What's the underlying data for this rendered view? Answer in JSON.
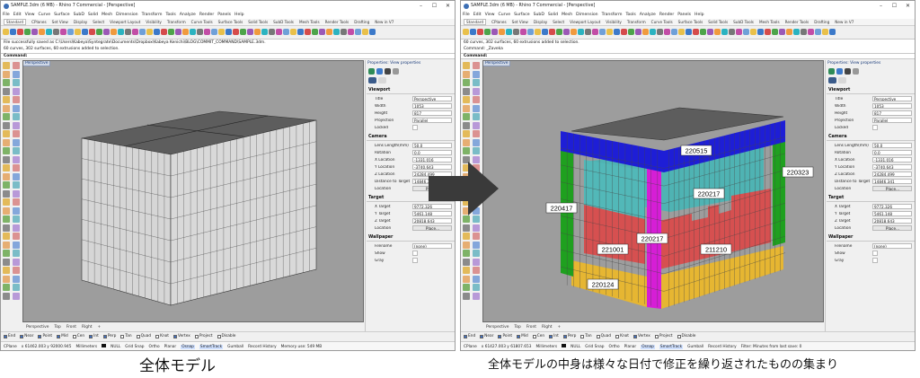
{
  "windows": [
    {
      "title": "SAMPLE.3dm (6 MB) - Rhino 7 Commercial - [Perspective]",
      "cmd_history": [
        "File successfully saved as C:\\Users\\Kabeya\\Syntegrate\\Documents\\Dropbox\\Kabeya Kenichi\\BLOG\\COMMIT_COMMAND\\SAMPLE.3dm.",
        "60 curves, 302 surfaces, 60 extrusions added to selection."
      ],
      "status": {
        "coords": "x 61462.003   y 92000.945",
        "units": "Millimeters",
        "memory": "Memory use: 549 MB"
      }
    },
    {
      "title": "SAMPLE.3dm (6 MB) - Rhino 7 Commercial - [Perspective]",
      "cmd_history": [
        "60 curves, 302 surfaces, 60 extrusions added to selection.",
        "Command: _Zaveka"
      ],
      "status": {
        "coords": "x 61427.003   y 61807.653",
        "units": "Millimeters",
        "memory": "Filter: Minutes from last save: 0"
      }
    }
  ],
  "menu": [
    "File",
    "Edit",
    "View",
    "Curve",
    "Surface",
    "SubD",
    "Solid",
    "Mesh",
    "Dimension",
    "Transform",
    "Tools",
    "Analyze",
    "Render",
    "Panels",
    "Help"
  ],
  "toolbar_tabs": [
    "Standard",
    "CPlanes",
    "Set View",
    "Display",
    "Select",
    "Viewport Layout",
    "Visibility",
    "Transform",
    "Curve Tools",
    "Surface Tools",
    "Solid Tools",
    "SubD Tools",
    "Mesh Tools",
    "Render Tools",
    "Drafting",
    "New in V7"
  ],
  "command_label": "Command:",
  "viewport_label": "Perspective",
  "viewport_tabs": [
    "Perspective",
    "Top",
    "Front",
    "Right",
    "+"
  ],
  "osnaps": [
    {
      "label": "End",
      "on": true
    },
    {
      "label": "Near",
      "on": true
    },
    {
      "label": "Point",
      "on": true
    },
    {
      "label": "Mid",
      "on": true
    },
    {
      "label": "Cen",
      "on": false
    },
    {
      "label": "Int",
      "on": true
    },
    {
      "label": "Perp",
      "on": true
    },
    {
      "label": "Tan",
      "on": false
    },
    {
      "label": "Quad",
      "on": false
    },
    {
      "label": "Knot",
      "on": false
    },
    {
      "label": "Vertex",
      "on": true
    },
    {
      "label": "Project",
      "on": false
    },
    {
      "label": "Disable",
      "on": false
    }
  ],
  "status_items": [
    "Grid Snap",
    "Ortho",
    "Planar",
    "Osnap",
    "SmartTrack",
    "Gumball",
    "Record History"
  ],
  "status_cplane": "CPlane",
  "status_null": "NULL",
  "properties": {
    "title": "Properties: View properties",
    "viewport_section": "Viewport",
    "viewport_rows": [
      {
        "key": "Title",
        "val": "Perspective"
      },
      {
        "key": "Width",
        "val": "1053"
      },
      {
        "key": "Height",
        "val": "817"
      },
      {
        "key": "Projection",
        "val": "Parallel"
      },
      {
        "key": "Locked",
        "val": ""
      }
    ],
    "camera_section": "Camera",
    "camera_rows": [
      {
        "key": "Lens Length(mm)",
        "val": "50.0"
      },
      {
        "key": "Rotation",
        "val": "0.0"
      },
      {
        "key": "X Location",
        "val": "-1331.016"
      },
      {
        "key": "Y Location",
        "val": "-3740.643"
      },
      {
        "key": "Z Location",
        "val": "24284.499"
      },
      {
        "key": "Distance to Target",
        "val": "14846.341"
      },
      {
        "key": "Location",
        "val": "Place..."
      }
    ],
    "target_section": "Target",
    "target_rows": [
      {
        "key": "X Target",
        "val": "9772.326"
      },
      {
        "key": "Y Target",
        "val": "5461.148"
      },
      {
        "key": "Z Target",
        "val": "20818.643"
      },
      {
        "key": "Location",
        "val": "Place..."
      }
    ],
    "wallpaper_section": "Wallpaper",
    "wallpaper_rows": [
      {
        "key": "Filename",
        "val": "(none)"
      },
      {
        "key": "Show",
        "val": ""
      },
      {
        "key": "Gray",
        "val": ""
      }
    ]
  },
  "labels": {
    "blue_top": "220515",
    "cyan_right": "220323",
    "cyan_main": "220217",
    "green_left": "220417",
    "magenta_mid": "220217",
    "red_left": "221001",
    "red_right": "211210",
    "yellow_bottom": "220124"
  },
  "colors": {
    "viewport_bg": "#9d9d9d",
    "box_face": "#d6d6d6",
    "box_top": "#5d5d5d",
    "blue": "#1e1ed6",
    "green": "#1fa01f",
    "cyan": "#4fb3b3",
    "magenta": "#d61ed6",
    "red": "#d65050",
    "yellow": "#e6b632"
  },
  "captions": {
    "left": "全体モデル",
    "right": "全体モデルの中身は様々な日付で修正を繰り返されたものの集まり"
  }
}
